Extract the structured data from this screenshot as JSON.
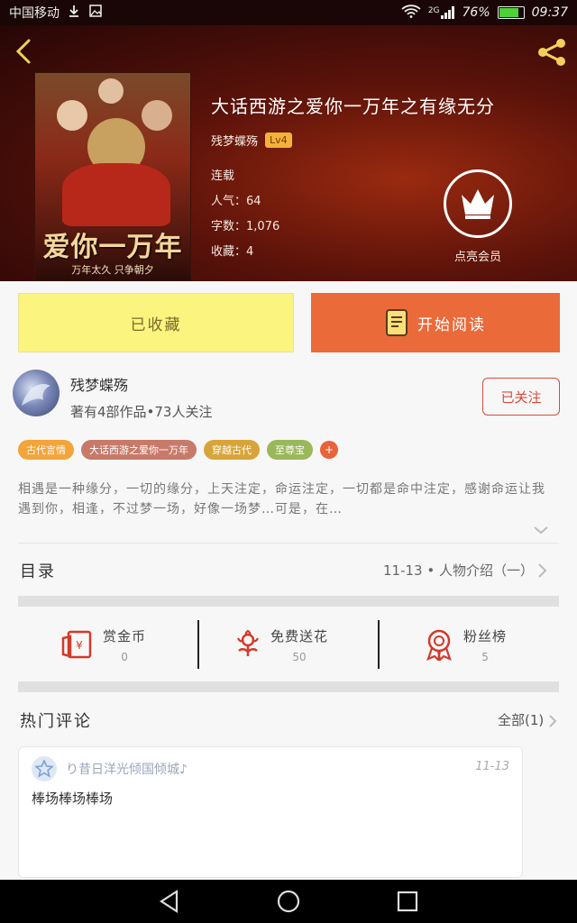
{
  "status_bar": {
    "carrier": "中国移动",
    "network": "2G",
    "battery": "76%",
    "battery_level": 0.76,
    "time": "09:37"
  },
  "book": {
    "title": "大话西游之爱你一万年之有缘无分",
    "cover_title": "爱你一万年",
    "cover_subtitle": "万年太久 只争朝夕",
    "author": "残梦蝶殇",
    "author_level": "Lv4",
    "status": "连载",
    "popularity_label": "人气：",
    "popularity": "64",
    "word_count_label": "字数：",
    "word_count": "1,076",
    "favorites_label": "收藏：",
    "favorites": "4",
    "vip_label": "点亮会员"
  },
  "actions": {
    "collected": "已收藏",
    "start_reading": "开始阅读"
  },
  "author_info": {
    "name": "残梦蝶殇",
    "stats": "著有4部作品•73人关注",
    "follow_label": "已关注"
  },
  "tags": [
    {
      "label": "古代言情",
      "color": "#f3a43a"
    },
    {
      "label": "大话西游之爱你一万年",
      "color": "#c87a6a"
    },
    {
      "label": "穿越古代",
      "color": "#d8a43a"
    },
    {
      "label": "至尊宝",
      "color": "#9ab85a"
    }
  ],
  "tag_more": "+",
  "synopsis": "相遇是一种缘分，一切的缘分，上天注定，命运注定，一切都是命中注定，感谢命运让我遇到你，相逢，不过梦一场，好像一场梦…可是，在…",
  "catalog": {
    "label": "目录",
    "latest": "11-13 • 人物介绍（一）"
  },
  "rewards": [
    {
      "label": "赏金币",
      "count": "0",
      "icon": "red-envelope-icon"
    },
    {
      "label": "免费送花",
      "count": "50",
      "icon": "flower-icon"
    },
    {
      "label": "粉丝榜",
      "count": "5",
      "icon": "medal-icon"
    }
  ],
  "comments": {
    "section_label": "热门评论",
    "all_label": "全部(1)",
    "items": [
      {
        "user": "り昔日洋光倾国倾城♪",
        "date": "11-13",
        "text": "棒场棒场棒场"
      }
    ]
  },
  "colors": {
    "accent_orange": "#ea6a3a",
    "collected_yellow": "#fbf47e",
    "follow_red": "#d94a3a"
  }
}
